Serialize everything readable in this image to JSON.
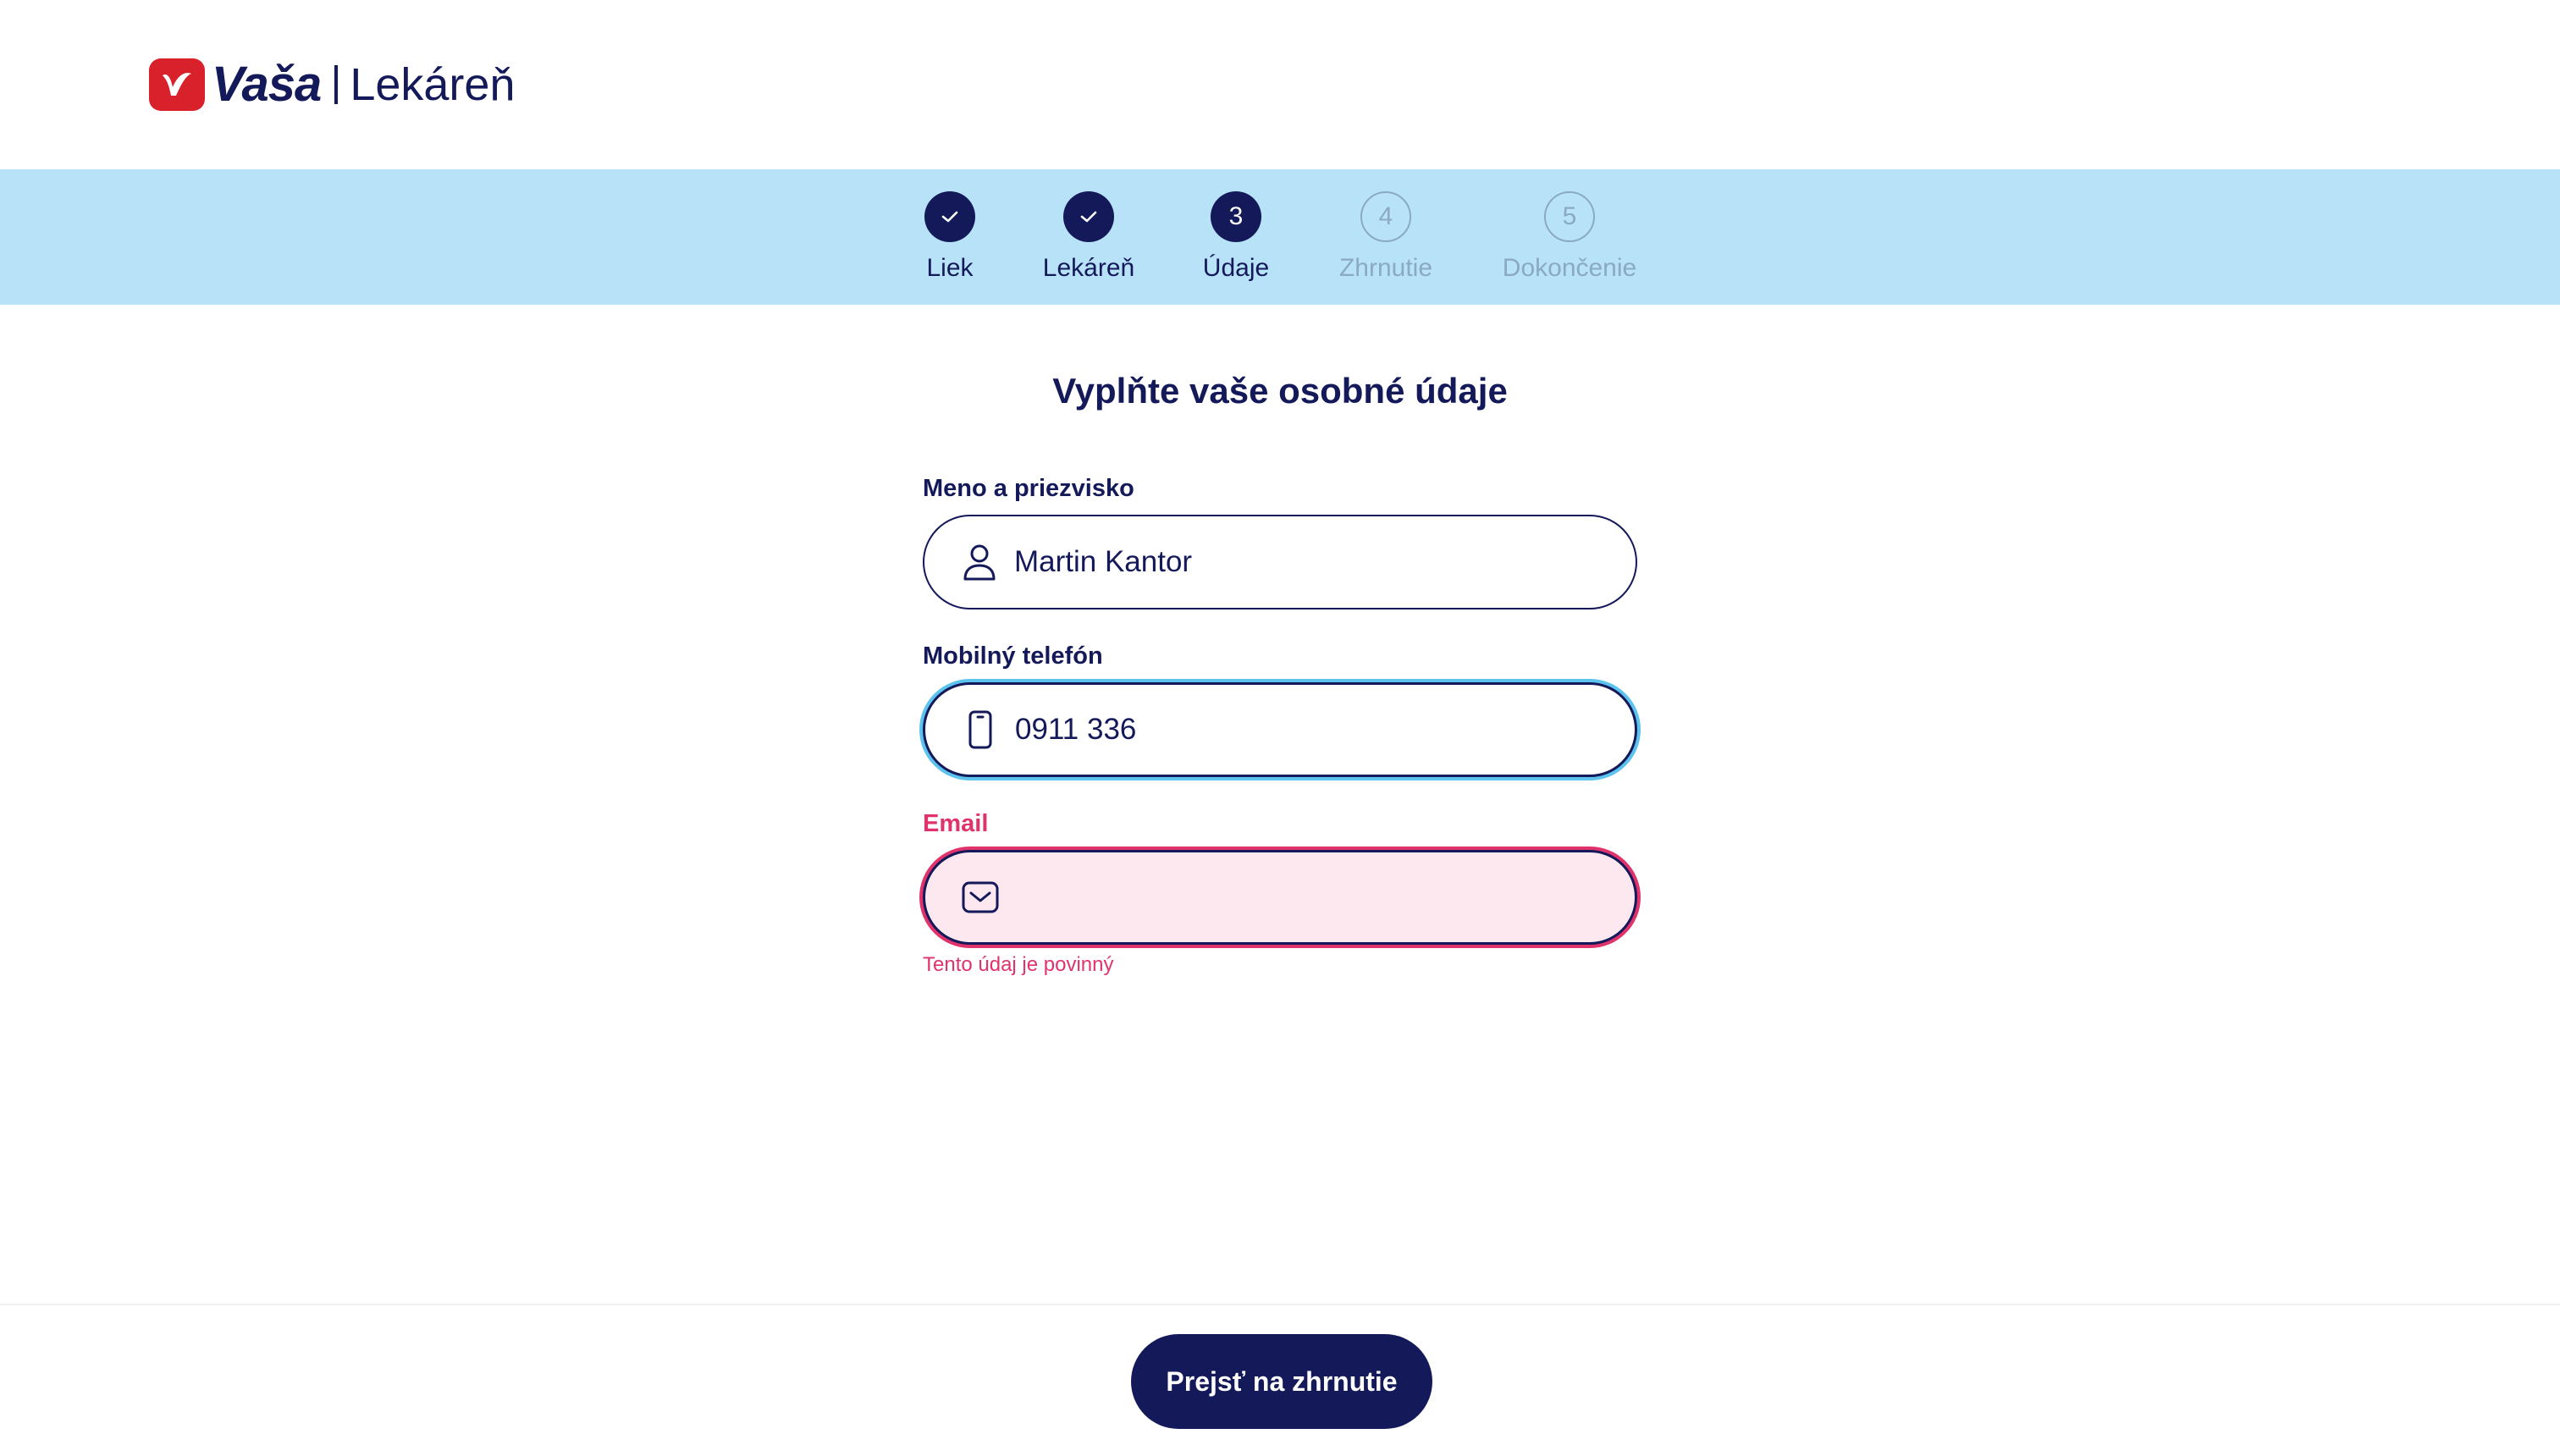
{
  "brand": {
    "name": "Vaša",
    "subtitle": "Lekáreň",
    "colors": {
      "primary": "#14195a",
      "logo_red": "#d9212c",
      "stepper_bg": "#b8e2f8",
      "error": "#e0336b",
      "focus": "#5cc3ee"
    }
  },
  "stepper": {
    "steps": [
      {
        "number": "1",
        "label": "Liek",
        "state": "done",
        "icon": "check-icon"
      },
      {
        "number": "2",
        "label": "Lekáreň",
        "state": "done",
        "icon": "check-icon"
      },
      {
        "number": "3",
        "label": "Údaje",
        "state": "active"
      },
      {
        "number": "4",
        "label": "Zhrnutie",
        "state": "todo"
      },
      {
        "number": "5",
        "label": "Dokončenie",
        "state": "todo"
      }
    ]
  },
  "form": {
    "title": "Vyplňte vaše osobné údaje",
    "name": {
      "label": "Meno a priezvisko",
      "value": "Martin Kantor",
      "icon": "person-icon"
    },
    "phone": {
      "label": "Mobilný telefón",
      "value": "0911 336",
      "icon": "phone-icon",
      "state": "focused"
    },
    "email": {
      "label": "Email",
      "value": "",
      "icon": "mail-icon",
      "state": "invalid",
      "error": "Tento údaj je povinný"
    }
  },
  "footer": {
    "submit_label": "Prejsť na zhrnutie"
  }
}
